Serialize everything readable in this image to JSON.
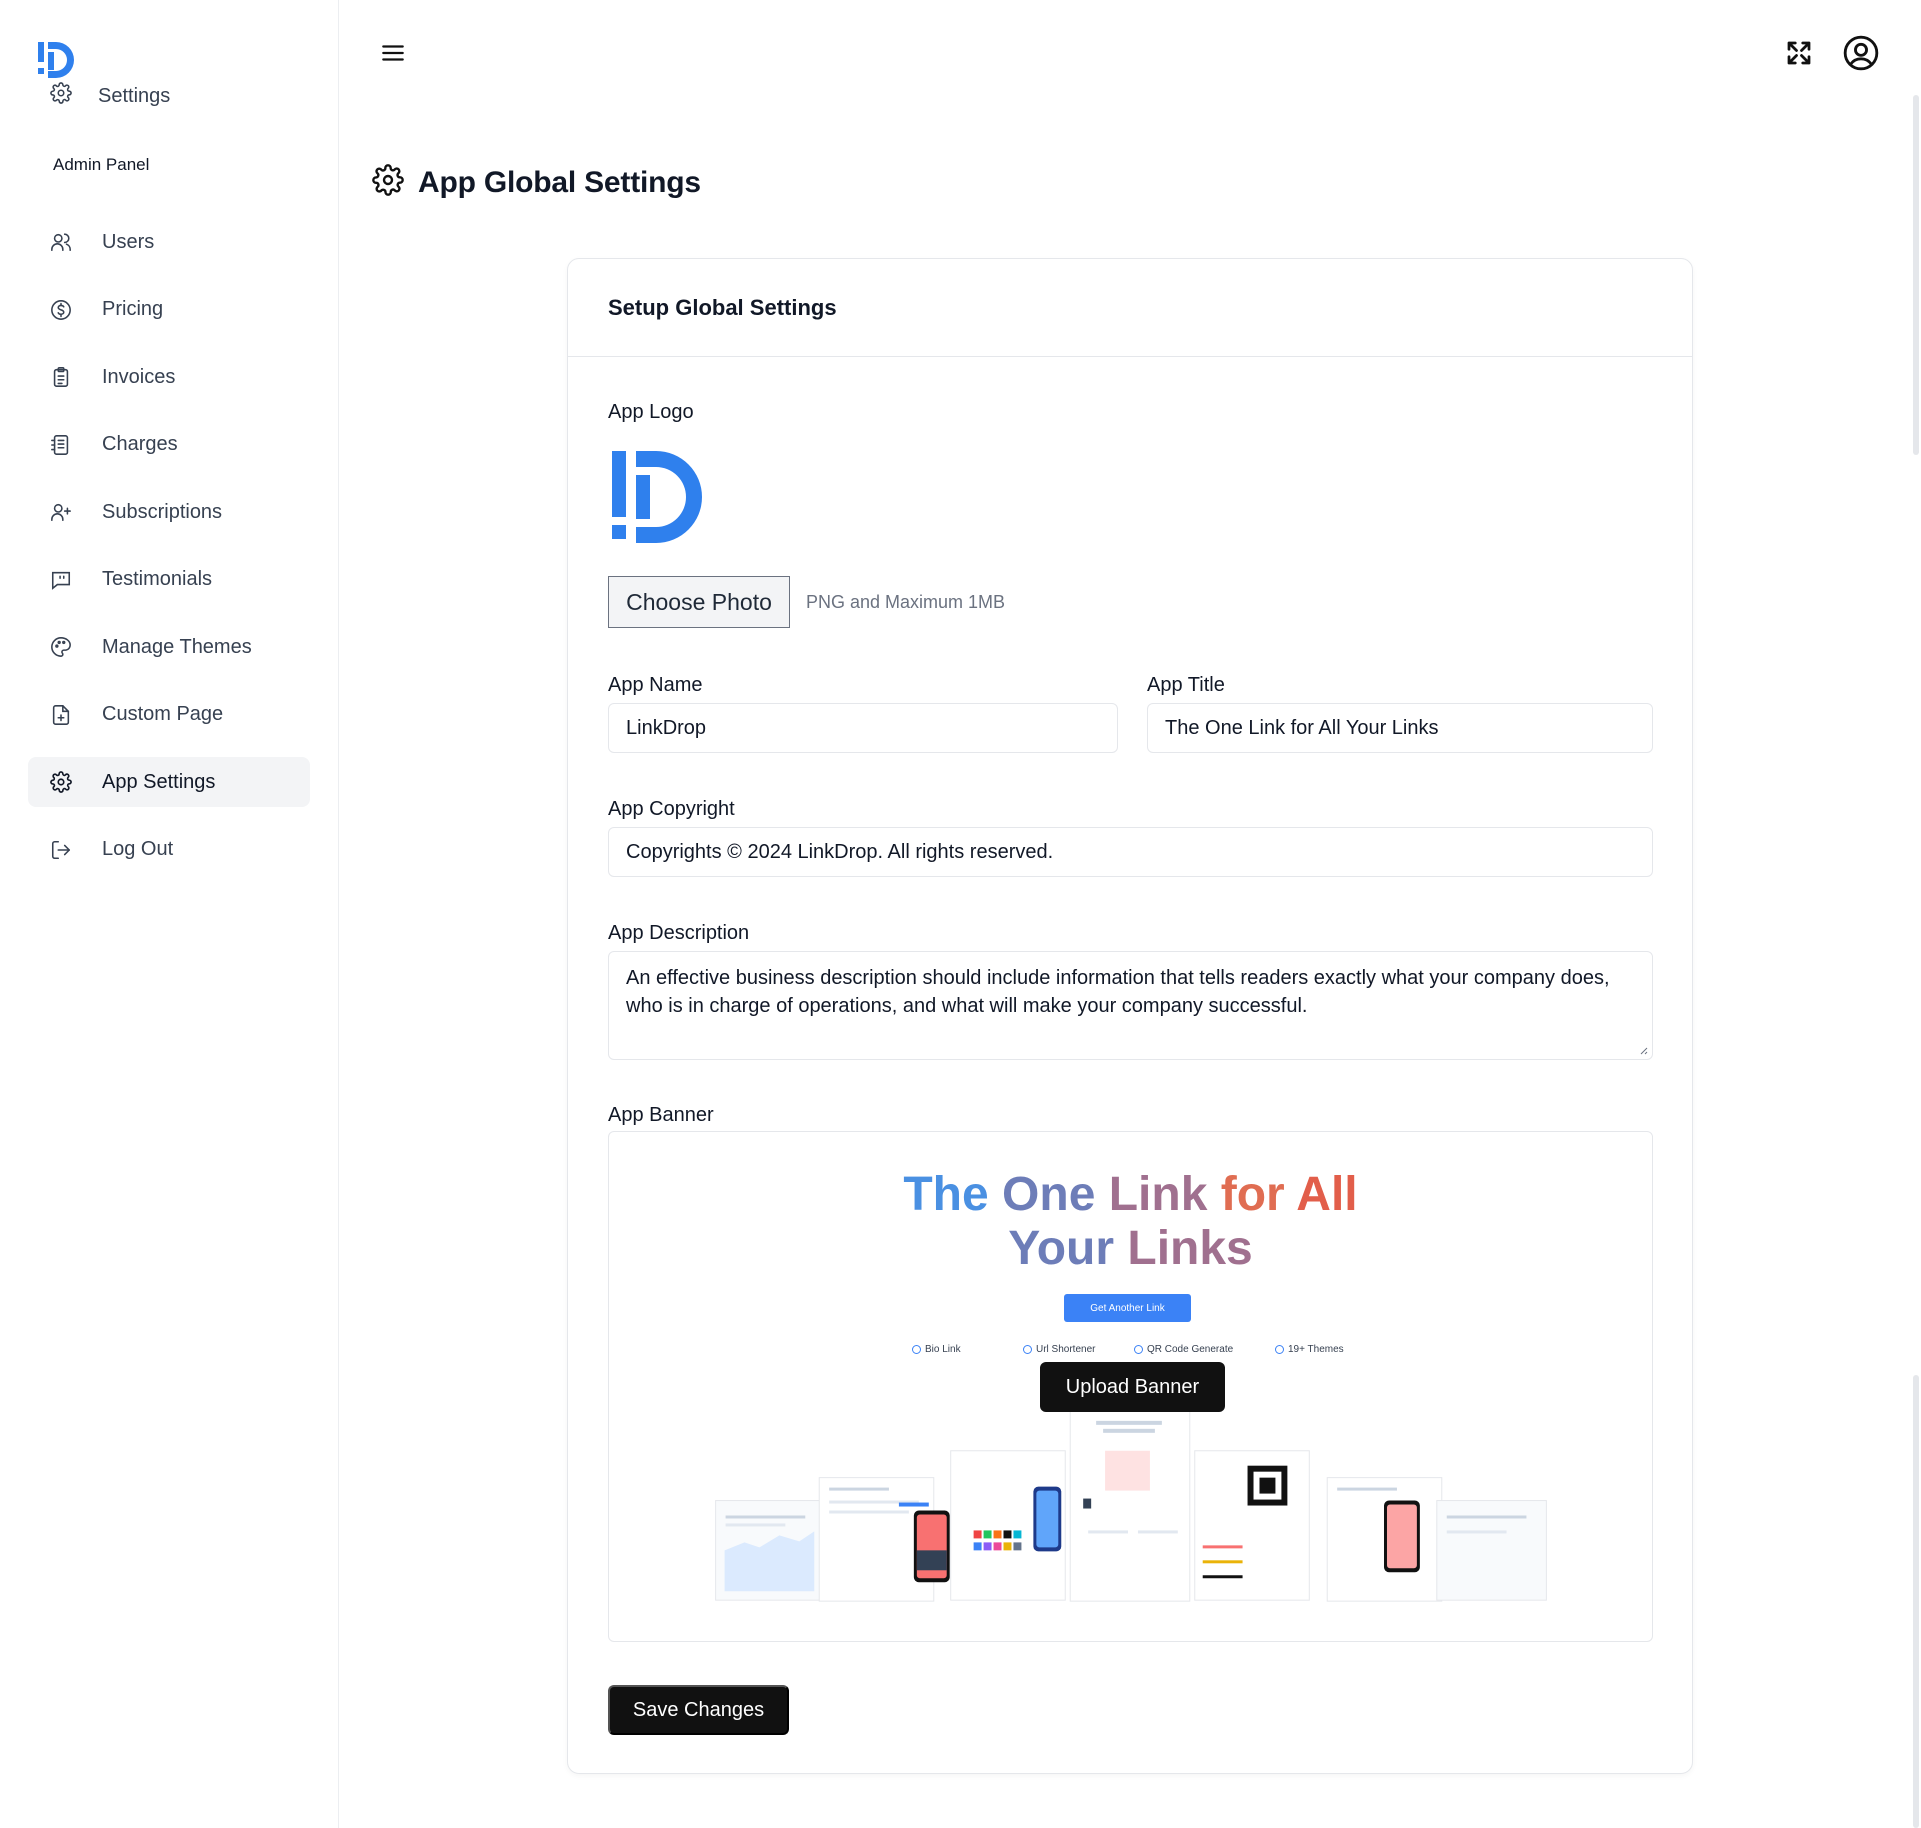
{
  "sidebar": {
    "top_item": {
      "label": "Settings",
      "icon": "gear-icon"
    },
    "section_title": "Admin Panel",
    "items": [
      {
        "label": "Users",
        "icon": "users-icon"
      },
      {
        "label": "Pricing",
        "icon": "dollar-circle-icon"
      },
      {
        "label": "Invoices",
        "icon": "clipboard-icon"
      },
      {
        "label": "Charges",
        "icon": "receipt-icon"
      },
      {
        "label": "Subscriptions",
        "icon": "user-plus-icon"
      },
      {
        "label": "Testimonials",
        "icon": "message-square-icon"
      },
      {
        "label": "Manage Themes",
        "icon": "palette-icon"
      },
      {
        "label": "Custom Page",
        "icon": "file-plus-icon"
      },
      {
        "label": "App Settings",
        "icon": "gear-icon",
        "active": true
      }
    ],
    "logout": {
      "label": "Log Out",
      "icon": "logout-icon"
    }
  },
  "header": {
    "menu_icon": "hamburger-icon",
    "fullscreen_icon": "fullscreen-icon",
    "profile_icon": "user-circle-icon"
  },
  "page": {
    "title": "App Global Settings",
    "title_icon": "gear-icon"
  },
  "card": {
    "title": "Setup Global Settings",
    "logo": {
      "label": "App Logo",
      "choose_button": "Choose Photo",
      "hint": "PNG and Maximum 1MB"
    },
    "app_name": {
      "label": "App Name",
      "value": "LinkDrop"
    },
    "app_title": {
      "label": "App Title",
      "value": "The One Link for All Your Links"
    },
    "app_copyright": {
      "label": "App Copyright",
      "value": "Copyrights © 2024 LinkDrop. All rights reserved."
    },
    "app_description": {
      "label": "App Description",
      "value": "An effective business description should include information that tells readers exactly what your company does, who is in charge of operations, and what will make your company successful."
    },
    "app_banner": {
      "label": "App Banner",
      "headline_line1_w1": "The",
      "headline_line1_w2": "One",
      "headline_line1_w3": "Link",
      "headline_line1_w4": "for",
      "headline_line1_w5": "All",
      "headline_line2_w1": "Your",
      "headline_line2_w2": "Links",
      "cta": "Get Another Link",
      "features": [
        "Bio Link",
        "Url Shortener",
        "QR Code Generate",
        "19+ Themes"
      ],
      "upload_button": "Upload Banner"
    },
    "save_button": "Save Changes"
  },
  "colors": {
    "brand_blue": "#2f80ed",
    "primary_dark": "#111111",
    "active_bg": "#f3f4f6",
    "border": "#e5e7eb"
  }
}
